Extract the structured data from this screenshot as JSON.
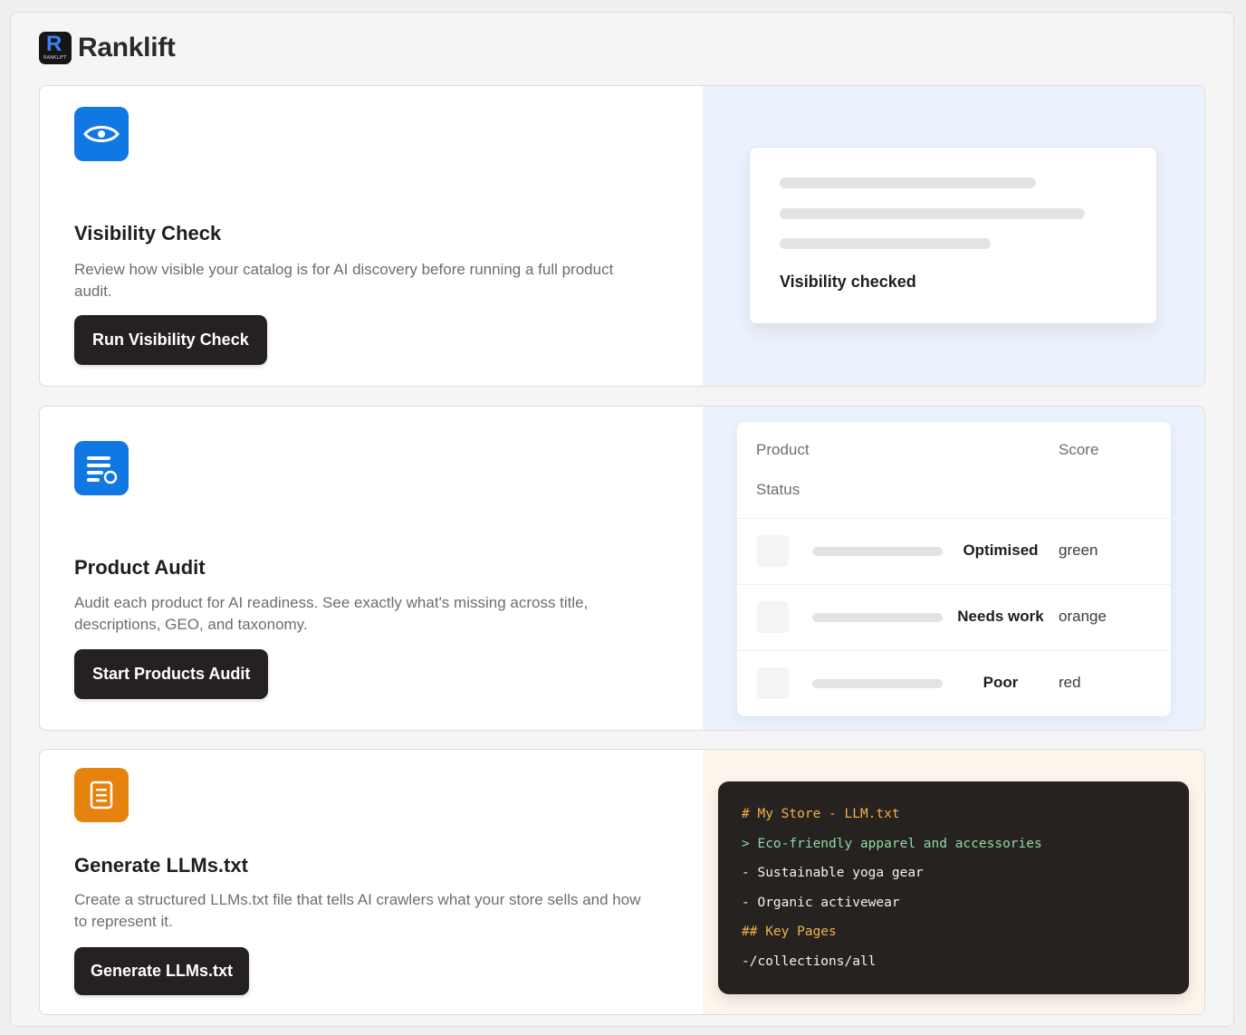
{
  "brand": {
    "name": "Ranklift",
    "logo_letter": "R",
    "logo_subtext": "RANKLIFT"
  },
  "visibility_check": {
    "title": "Visibility Check",
    "description": "Review how visible your catalog is for AI discovery before running a full product audit.",
    "button_label": "Run Visibility Check",
    "icon": "eye-icon",
    "icon_color": "#1177e3",
    "preview_status": "Visibility checked"
  },
  "product_audit": {
    "title": "Product Audit",
    "description": "Audit each product for AI readiness. See exactly what's missing across title, descriptions, GEO, and taxonomy.",
    "button_label": "Start Products Audit",
    "icon": "list-check-icon",
    "icon_color": "#1177e3",
    "table": {
      "headers": {
        "product": "Product",
        "score": "Score",
        "status": "Status"
      },
      "rows": [
        {
          "status": "Optimised",
          "score": "green"
        },
        {
          "status": "Needs work",
          "score": "orange"
        },
        {
          "status": "Poor",
          "score": "red"
        }
      ]
    }
  },
  "llms_txt": {
    "title": "Generate LLMs.txt",
    "description": "Create a structured LLMs.txt file that tells AI crawlers what your store sells and how to represent it.",
    "button_label": "Generate LLMs.txt",
    "icon": "document-icon",
    "icon_color": "#e6820e",
    "code_lines": [
      {
        "text": "# My Store - LLM.txt",
        "color": "#f1b34b"
      },
      {
        "text": "> Eco-friendly apparel and accessories",
        "color": "#8fd9a8"
      },
      {
        "text": "- Sustainable yoga gear",
        "color": "#f2f2f2"
      },
      {
        "text": "- Organic activewear",
        "color": "#f2f2f2"
      },
      {
        "text": "## Key Pages",
        "color": "#f1b34b"
      },
      {
        "text": "-/collections/all",
        "color": "#f2f2f2"
      }
    ]
  }
}
